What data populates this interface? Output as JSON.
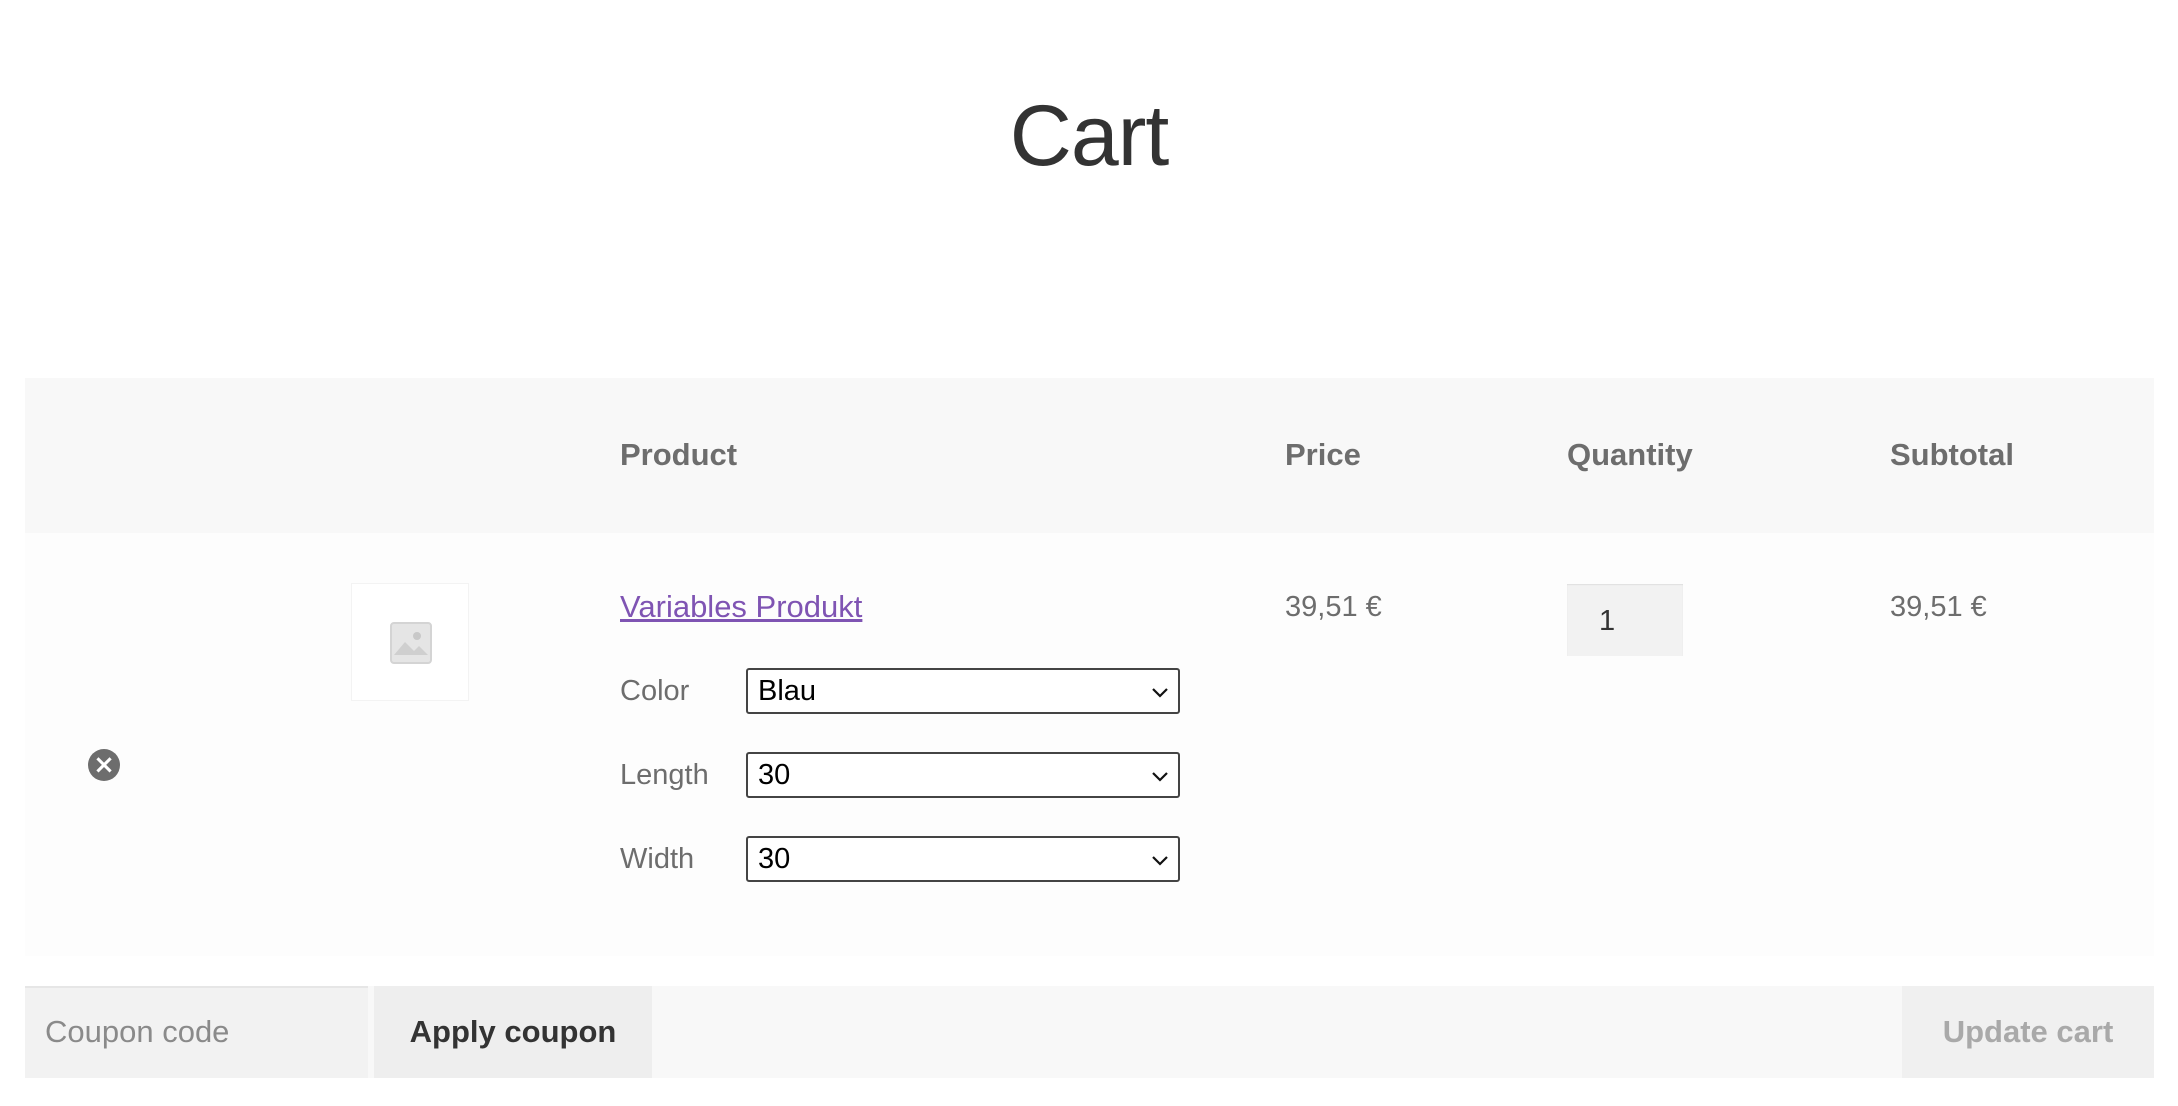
{
  "page": {
    "title": "Cart"
  },
  "table": {
    "headers": {
      "product": "Product",
      "price": "Price",
      "quantity": "Quantity",
      "subtotal": "Subtotal"
    }
  },
  "cart_item": {
    "remove_icon": "close-circle-icon",
    "thumbnail_icon": "image-placeholder-icon",
    "product_name": "Variables Produkt",
    "attributes": [
      {
        "label": "Color",
        "value": "Blau"
      },
      {
        "label": "Length",
        "value": "30"
      },
      {
        "label": "Width",
        "value": "30"
      }
    ],
    "price": "39,51 €",
    "quantity": "1",
    "subtotal": "39,51 €"
  },
  "actions": {
    "coupon_placeholder": "Coupon code",
    "apply_coupon_label": "Apply coupon",
    "update_cart_label": "Update cart"
  },
  "colors": {
    "link": "#7f54b3",
    "header_bg": "#f8f8f8",
    "text": "#6d6d6d",
    "title": "#333333"
  }
}
